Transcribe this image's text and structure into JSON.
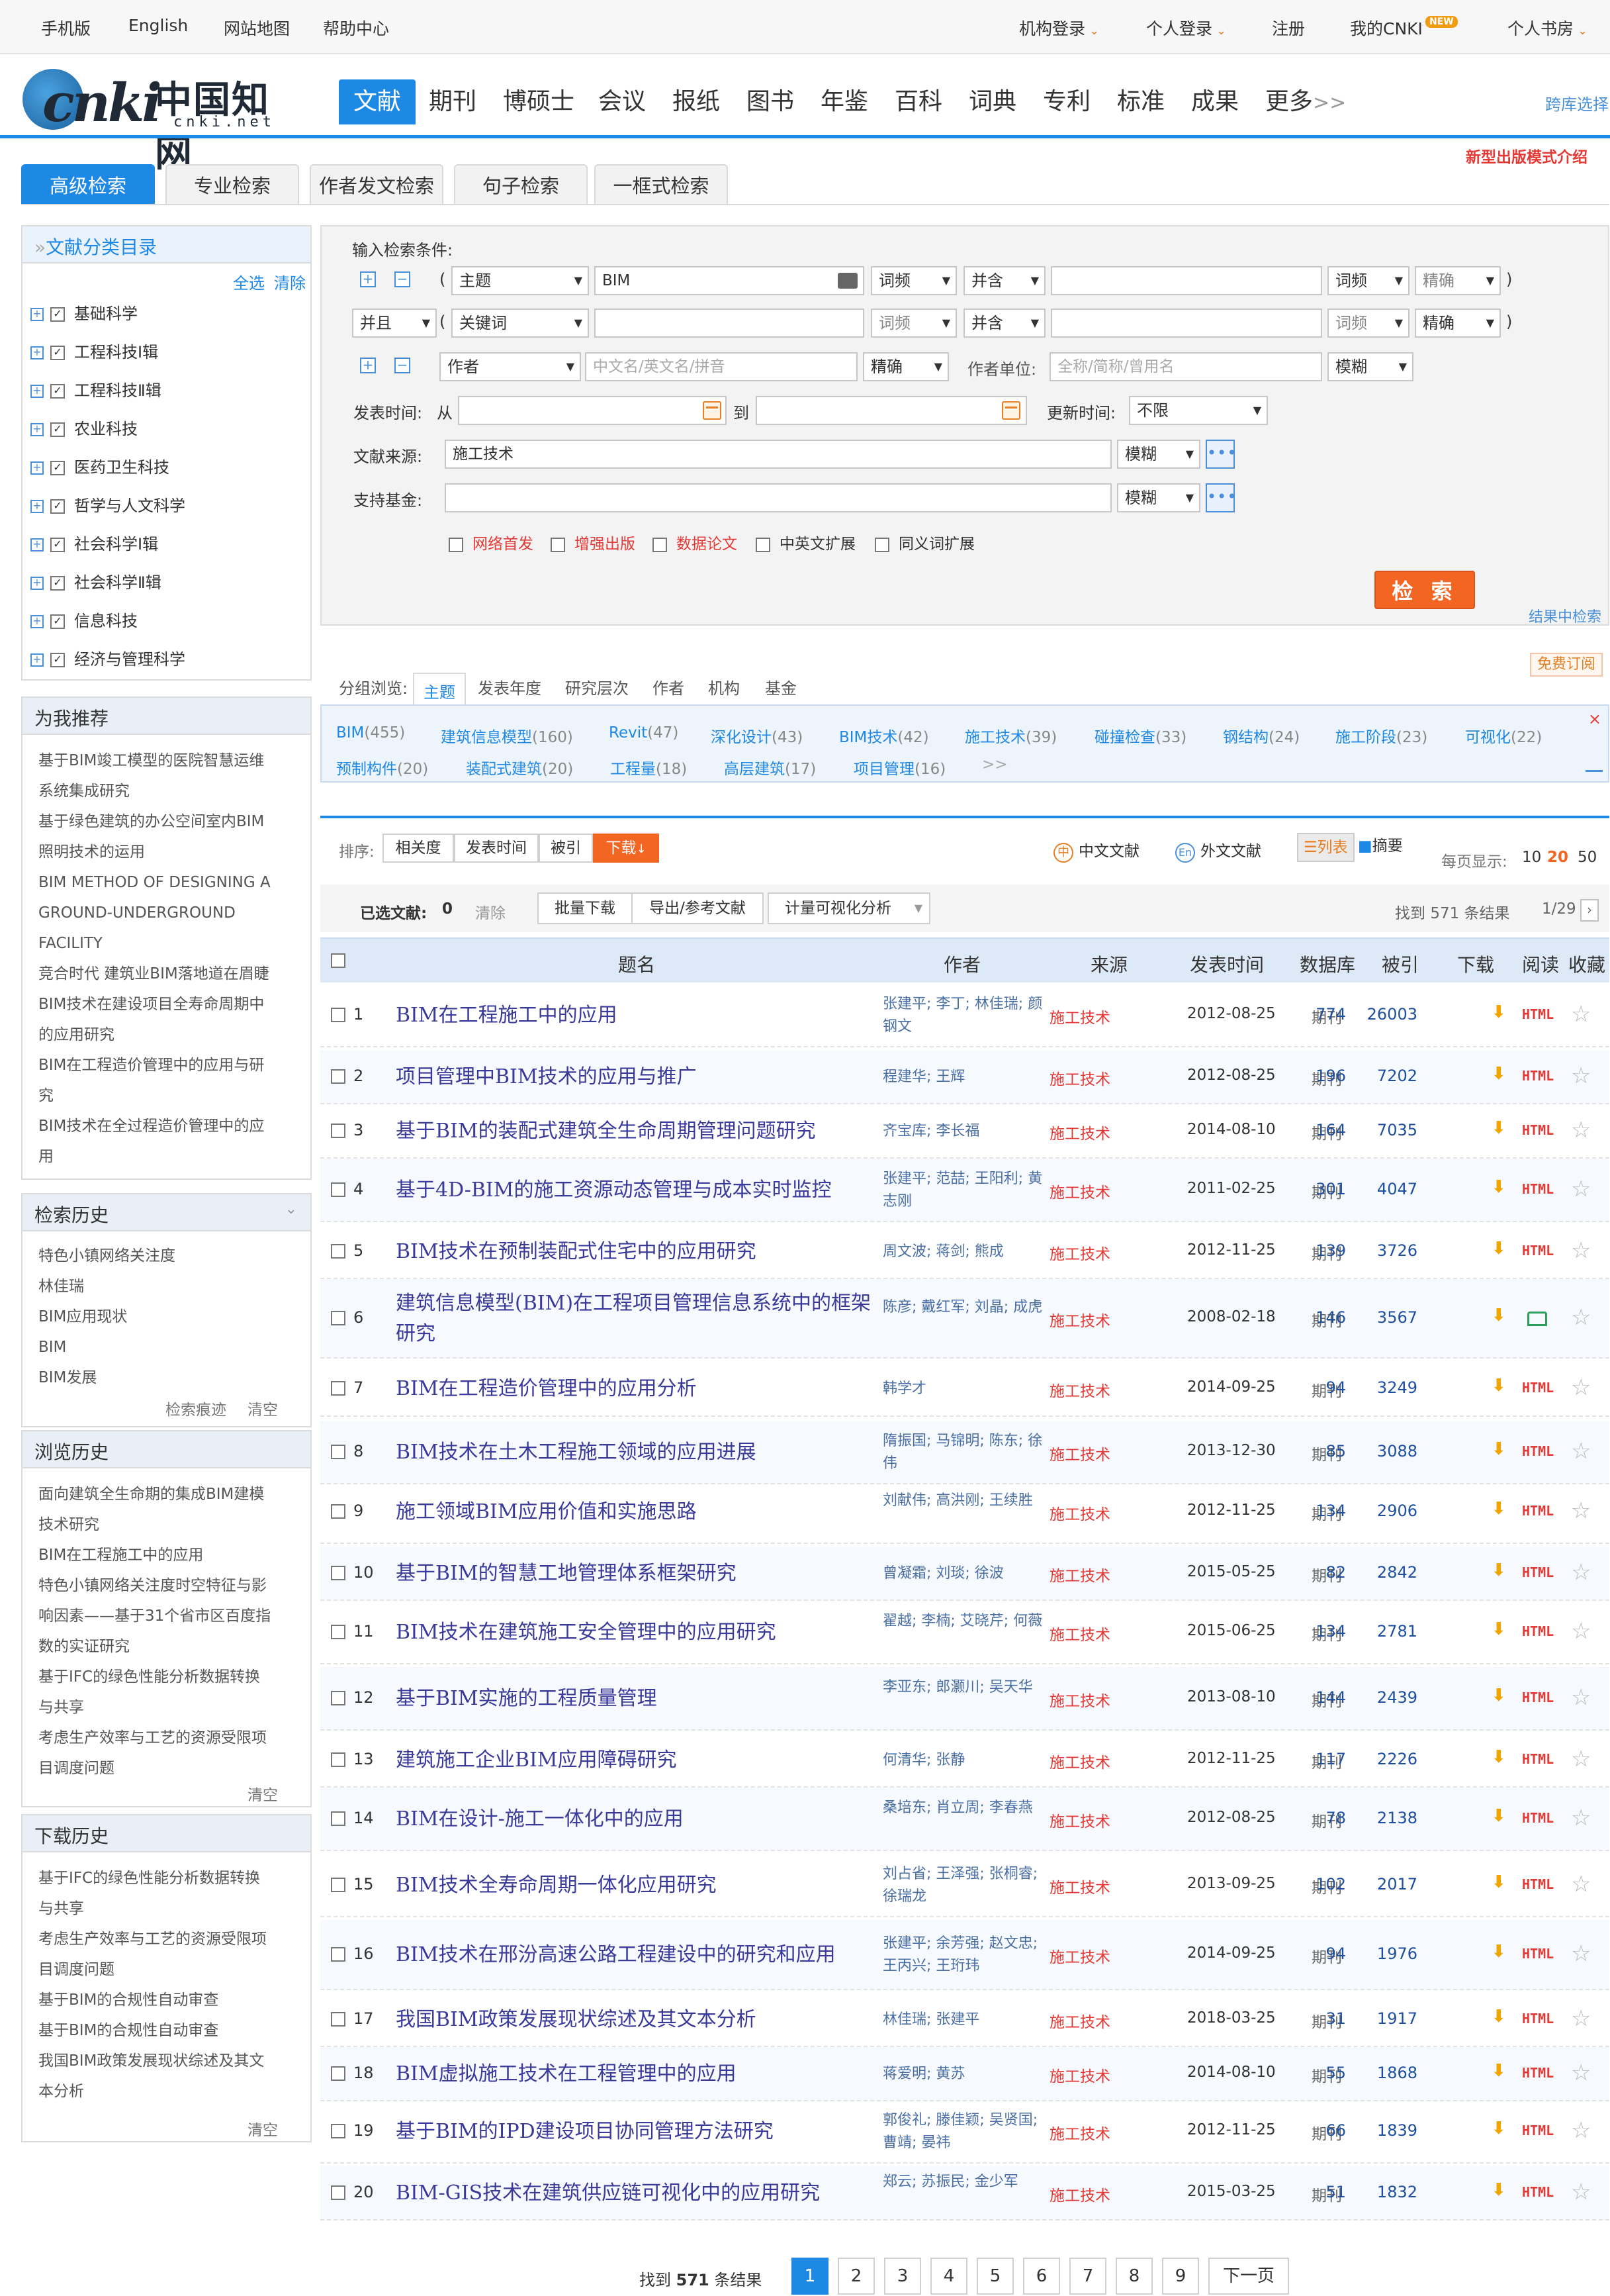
{
  "topbar": {
    "mobile": "手机版",
    "english": "English",
    "sitemap": "网站地图",
    "help": "帮助中心",
    "org_login": "机构登录",
    "personal_login": "个人登录",
    "register": "注册",
    "my_cnki": "我的CNKI",
    "new_badge": "NEW",
    "bookshelf": "个人书房"
  },
  "logo": {
    "word": "cnki",
    "chinese": "中国知网",
    "domain": "cnki.net"
  },
  "nav": [
    "文献",
    "期刊",
    "博硕士",
    "会议",
    "报纸",
    "图书",
    "年鉴",
    "百科",
    "词典",
    "专利",
    "标准",
    "成果",
    "更多"
  ],
  "nav_more_suffix": ">>",
  "cross_db": "跨库选择",
  "new_model": "新型出版模式介绍",
  "search_tabs": [
    "高级检索",
    "专业检索",
    "作者发文检索",
    "句子检索",
    "一框式检索"
  ],
  "category_panel": {
    "title": "文献分类目录",
    "select_all": "全选",
    "clear": "清除",
    "items": [
      "基础科学",
      "工程科技Ⅰ辑",
      "工程科技Ⅱ辑",
      "农业科技",
      "医药卫生科技",
      "哲学与人文科学",
      "社会科学Ⅰ辑",
      "社会科学Ⅱ辑",
      "信息科技",
      "经济与管理科学"
    ]
  },
  "recommend_panel": {
    "title": "为我推荐",
    "items": [
      [
        "基于BIM竣工模型的医院智慧运维",
        "系统集成研究"
      ],
      [
        "基于绿色建筑的办公空间室内BIM",
        "照明技术的运用"
      ],
      [
        "BIM METHOD OF DESIGNING A",
        "GROUND-UNDERGROUND",
        "FACILITY"
      ],
      [
        "竞合时代 建筑业BIM落地道在眉睫"
      ],
      [
        "BIM技术在建设项目全寿命周期中",
        "的应用研究"
      ],
      [
        "BIM在工程造价管理中的应用与研",
        "究"
      ],
      [
        "BIM技术在全过程造价管理中的应",
        "用"
      ]
    ]
  },
  "history_panel": {
    "title": "检索历史",
    "items": [
      "特色小镇网络关注度",
      "林佳瑞",
      "BIM应用现状",
      "BIM",
      "BIM发展"
    ],
    "trace": "检索痕迹",
    "clear": "清空"
  },
  "browse_panel": {
    "title": "浏览历史",
    "items": [
      [
        "面向建筑全生命期的集成BIM建模",
        "技术研究"
      ],
      [
        "BIM在工程施工中的应用"
      ],
      [
        "特色小镇网络关注度时空特征与影",
        "响因素——基于31个省市区百度指",
        "数的实证研究"
      ],
      [
        "基于IFC的绿色性能分析数据转换",
        "与共享"
      ],
      [
        "考虑生产效率与工艺的资源受限项",
        "目调度问题"
      ]
    ],
    "clear": "清空"
  },
  "download_panel": {
    "title": "下载历史",
    "items": [
      [
        "基于IFC的绿色性能分析数据转换",
        "与共享"
      ],
      [
        "考虑生产效率与工艺的资源受限项",
        "目调度问题"
      ],
      [
        "基于BIM的合规性自动审查"
      ],
      [
        "基于BIM的合规性自动审查"
      ],
      [
        "我国BIM政策发展现状综述及其文",
        "本分析"
      ]
    ],
    "clear": "清空"
  },
  "form": {
    "input_label": "输入检索条件:",
    "row1": {
      "field": "主题",
      "value": "BIM",
      "freq": "词频",
      "combine": "并含",
      "freq2": "词频",
      "match": "精确"
    },
    "row2": {
      "logic": "并且",
      "field": "关键词",
      "freq": "词频",
      "combine": "并含",
      "freq2": "词频",
      "match": "精确"
    },
    "row3": {
      "field": "作者",
      "author_placeholder": "中文名/英文名/拼音",
      "match": "精确",
      "org_label": "作者单位:",
      "org_placeholder": "全称/简称/曾用名",
      "org_match": "模糊"
    },
    "pubtime_label": "发表时间:",
    "from": "从",
    "to": "到",
    "update_label": "更新时间:",
    "update_value": "不限",
    "source_label": "文献来源:",
    "source_value": "施工技术",
    "source_match": "模糊",
    "fund_label": "支持基金:",
    "fund_match": "模糊",
    "options": [
      "网络首发",
      "增强出版",
      "数据论文",
      "中英文扩展",
      "同义词扩展"
    ],
    "search_button": "检 索",
    "in_result": "结果中检索",
    "free_subscribe": "免费订阅"
  },
  "grouping": {
    "label": "分组浏览:",
    "tabs": [
      "主题",
      "发表年度",
      "研究层次",
      "作者",
      "机构",
      "基金"
    ],
    "items": [
      {
        "name": "BIM",
        "count": "(455)"
      },
      {
        "name": "建筑信息模型",
        "count": "(160)"
      },
      {
        "name": "Revit",
        "count": "(47)"
      },
      {
        "name": "深化设计",
        "count": "(43)"
      },
      {
        "name": "BIM技术",
        "count": "(42)"
      },
      {
        "name": "施工技术",
        "count": "(39)"
      },
      {
        "name": "碰撞检查",
        "count": "(33)"
      },
      {
        "name": "钢结构",
        "count": "(24)"
      },
      {
        "name": "施工阶段",
        "count": "(23)"
      },
      {
        "name": "可视化",
        "count": "(22)"
      },
      {
        "name": "预制构件",
        "count": "(20)"
      },
      {
        "name": "装配式建筑",
        "count": "(20)"
      },
      {
        "name": "工程量",
        "count": "(18)"
      },
      {
        "name": "高层建筑",
        "count": "(17)"
      },
      {
        "name": "项目管理",
        "count": "(16)"
      }
    ],
    "more": ">>"
  },
  "sortbar": {
    "label": "排序:",
    "options": [
      "相关度",
      "发表时间",
      "被引",
      "下载"
    ],
    "cn_docs": "中文文献",
    "foreign_docs": "外文文献",
    "list_view": "列表",
    "abstract_view": "摘要",
    "per_page_label": "每页显示:",
    "per_page": [
      "10",
      "20",
      "50"
    ]
  },
  "selbar": {
    "selected_label": "已选文献:",
    "selected_count": "0",
    "clear": "清除",
    "batch_download": "批量下载",
    "export": "导出/参考文献",
    "viz": "计量可视化分析",
    "found_prefix": "找到",
    "found_count": "571",
    "found_suffix": "条结果",
    "page_info": "1/29"
  },
  "table": {
    "headers": [
      "题名",
      "作者",
      "来源",
      "发表时间",
      "数据库",
      "被引",
      "下载",
      "阅读",
      "收藏"
    ],
    "rows": [
      {
        "n": "1",
        "title": "BIM在工程施工中的应用",
        "authors": "张建平; 李丁; 林佳瑞; 颜钢文",
        "source": "施工技术",
        "date": "2012-08-25",
        "db": "期刊",
        "cite": "774",
        "dl": "26003",
        "read": "HTML"
      },
      {
        "n": "2",
        "title": "项目管理中BIM技术的应用与推广",
        "authors": "程建华; 王辉",
        "source": "施工技术",
        "date": "2012-08-25",
        "db": "期刊",
        "cite": "196",
        "dl": "7202",
        "read": "HTML"
      },
      {
        "n": "3",
        "title": "基于BIM的装配式建筑全生命周期管理问题研究",
        "authors": "齐宝库; 李长福",
        "source": "施工技术",
        "date": "2014-08-10",
        "db": "期刊",
        "cite": "164",
        "dl": "7035",
        "read": "HTML"
      },
      {
        "n": "4",
        "title": "基于4D-BIM的施工资源动态管理与成本实时监控",
        "authors": "张建平; 范喆; 王阳利; 黄志刚",
        "source": "施工技术",
        "date": "2011-02-25",
        "db": "期刊",
        "cite": "301",
        "dl": "4047",
        "read": "HTML"
      },
      {
        "n": "5",
        "title": "BIM技术在预制装配式住宅中的应用研究",
        "authors": "周文波; 蒋剑; 熊成",
        "source": "施工技术",
        "date": "2012-11-25",
        "db": "期刊",
        "cite": "139",
        "dl": "3726",
        "read": "HTML"
      },
      {
        "n": "6",
        "title": "建筑信息模型(BIM)在工程项目管理信息系统中的框架研究",
        "authors": "陈彦; 戴红军; 刘晶; 成虎",
        "source": "施工技术",
        "date": "2008-02-18",
        "db": "期刊",
        "cite": "146",
        "dl": "3567",
        "read": "book"
      },
      {
        "n": "7",
        "title": "BIM在工程造价管理中的应用分析",
        "authors": "韩学才",
        "source": "施工技术",
        "date": "2014-09-25",
        "db": "期刊",
        "cite": "94",
        "dl": "3249",
        "read": "HTML"
      },
      {
        "n": "8",
        "title": "BIM技术在土木工程施工领域的应用进展",
        "authors": "隋振国; 马锦明; 陈东; 徐伟",
        "source": "施工技术",
        "date": "2013-12-30",
        "db": "期刊",
        "cite": "85",
        "dl": "3088",
        "read": "HTML"
      },
      {
        "n": "9",
        "title": "施工领域BIM应用价值和实施思路",
        "authors": "刘献伟; 高洪刚; 王续胜",
        "source": "施工技术",
        "date": "2012-11-25",
        "db": "期刊",
        "cite": "134",
        "dl": "2906",
        "read": "HTML"
      },
      {
        "n": "10",
        "title": "基于BIM的智慧工地管理体系框架研究",
        "authors": "曾凝霜; 刘琰; 徐波",
        "source": "施工技术",
        "date": "2015-05-25",
        "db": "期刊",
        "cite": "82",
        "dl": "2842",
        "read": "HTML"
      },
      {
        "n": "11",
        "title": "BIM技术在建筑施工安全管理中的应用研究",
        "authors": "翟越; 李楠; 艾晓芹; 何薇",
        "source": "施工技术",
        "date": "2015-06-25",
        "db": "期刊",
        "cite": "134",
        "dl": "2781",
        "read": "HTML"
      },
      {
        "n": "12",
        "title": "基于BIM实施的工程质量管理",
        "authors": "李亚东; 郎灏川; 吴天华",
        "source": "施工技术",
        "date": "2013-08-10",
        "db": "期刊",
        "cite": "144",
        "dl": "2439",
        "read": "HTML"
      },
      {
        "n": "13",
        "title": "建筑施工企业BIM应用障碍研究",
        "authors": "何清华; 张静",
        "source": "施工技术",
        "date": "2012-11-25",
        "db": "期刊",
        "cite": "117",
        "dl": "2226",
        "read": "HTML"
      },
      {
        "n": "14",
        "title": "BIM在设计-施工一体化中的应用",
        "authors": "桑培东; 肖立周; 李春燕",
        "source": "施工技术",
        "date": "2012-08-25",
        "db": "期刊",
        "cite": "78",
        "dl": "2138",
        "read": "HTML"
      },
      {
        "n": "15",
        "title": "BIM技术全寿命周期一体化应用研究",
        "authors": "刘占省; 王泽强; 张桐睿; 徐瑞龙",
        "source": "施工技术",
        "date": "2013-09-25",
        "db": "期刊",
        "cite": "102",
        "dl": "2017",
        "read": "HTML"
      },
      {
        "n": "16",
        "title": "BIM技术在邢汾高速公路工程建设中的研究和应用",
        "authors": "张建平; 余芳强; 赵文忠; 王丙兴; 王珩玮",
        "source": "施工技术",
        "date": "2014-09-25",
        "db": "期刊",
        "cite": "94",
        "dl": "1976",
        "read": "HTML"
      },
      {
        "n": "17",
        "title": "我国BIM政策发展现状综述及其文本分析",
        "authors": "林佳瑞; 张建平",
        "source": "施工技术",
        "date": "2018-03-25",
        "db": "期刊",
        "cite": "31",
        "dl": "1917",
        "read": "HTML"
      },
      {
        "n": "18",
        "title": "BIM虚拟施工技术在工程管理中的应用",
        "authors": "蒋爱明; 黄苏",
        "source": "施工技术",
        "date": "2014-08-10",
        "db": "期刊",
        "cite": "55",
        "dl": "1868",
        "read": "HTML"
      },
      {
        "n": "19",
        "title": "基于BIM的IPD建设项目协同管理方法研究",
        "authors": "郭俊礼; 滕佳颖; 吴贤国; 曹靖; 晏祎",
        "source": "施工技术",
        "date": "2012-11-25",
        "db": "期刊",
        "cite": "66",
        "dl": "1839",
        "read": "HTML"
      },
      {
        "n": "20",
        "title": "BIM-GIS技术在建筑供应链可视化中的应用研究",
        "authors": "郑云; 苏振民; 金少军",
        "source": "施工技术",
        "date": "2015-03-25",
        "db": "期刊",
        "cite": "51",
        "dl": "1832",
        "read": "HTML"
      }
    ]
  },
  "pager": {
    "found_prefix": "找到",
    "found_count": "571",
    "found_suffix": "条结果",
    "pages": [
      "1",
      "2",
      "3",
      "4",
      "5",
      "6",
      "7",
      "8",
      "9"
    ],
    "next": "下一页"
  },
  "colors": {
    "accent": "#1e88e5",
    "orange": "#f26522",
    "red": "#e53935"
  }
}
